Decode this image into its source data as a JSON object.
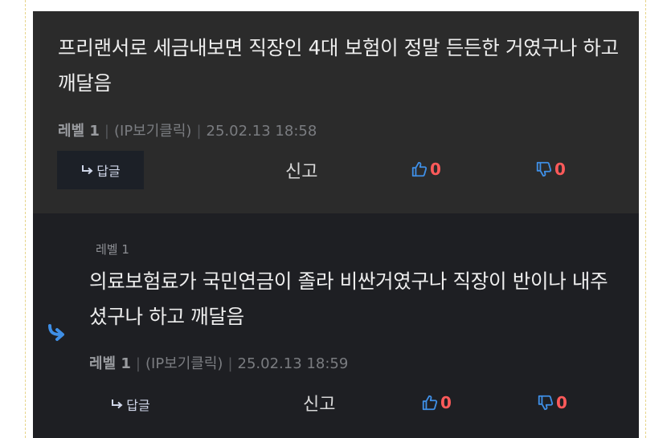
{
  "comments": [
    {
      "text": "프리랜서로 세금내보면 직장인 4대 보험이 정말 든든한 거였구나 하고 깨달음",
      "level": "레벨 1",
      "ip": "(IP보기클릭)",
      "datetime": "25.02.13 18:58",
      "reply_label": "답글",
      "report_label": "신고",
      "up_count": "0",
      "down_count": "0"
    },
    {
      "level_small": "레벨 1",
      "text": "의료보험료가 국민연금이 졸라 비싼거였구나  직장이 반이나 내주셨구나 하고 깨달음",
      "level": "레벨 1",
      "ip": "(IP보기클릭)",
      "datetime": "25.02.13 18:59",
      "reply_label": "답글",
      "report_label": "신고",
      "up_count": "0",
      "down_count": "0"
    }
  ],
  "colors": {
    "accent_blue": "#3f8fe6",
    "vote_red": "#ff5a5a",
    "comment_bg": "#2b2b2b",
    "reply_bg": "#1e1f23"
  }
}
